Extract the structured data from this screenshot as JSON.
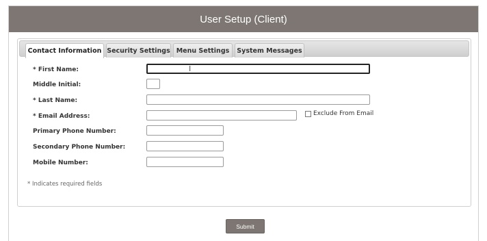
{
  "window": {
    "title": "User Setup (Client)"
  },
  "tabs": [
    {
      "label": "Contact Information",
      "active": true
    },
    {
      "label": "Security Settings",
      "active": false
    },
    {
      "label": "Menu Settings",
      "active": false
    },
    {
      "label": "System Messages",
      "active": false
    }
  ],
  "form": {
    "first_name": {
      "label": "* First Name:",
      "value": ""
    },
    "middle_initial": {
      "label": "Middle Initial:",
      "value": ""
    },
    "last_name": {
      "label": "* Last Name:",
      "value": ""
    },
    "email": {
      "label": "* Email Address:",
      "value": ""
    },
    "exclude_email": {
      "label": "Exclude From Email",
      "checked": false
    },
    "primary_phone": {
      "label": "Primary Phone Number:",
      "value": ""
    },
    "secondary_phone": {
      "label": "Secondary Phone Number:",
      "value": ""
    },
    "mobile": {
      "label": "Mobile Number:",
      "value": ""
    },
    "required_note": "* Indicates required fields"
  },
  "actions": {
    "submit_label": "Submit"
  },
  "colors": {
    "titlebar": "#7d7673",
    "button": "#7d7673"
  }
}
